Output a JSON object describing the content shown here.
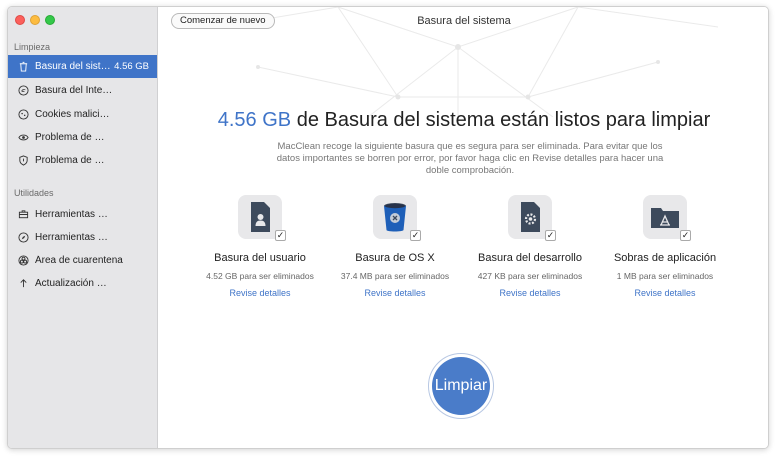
{
  "window": {
    "title": "Basura del sistema"
  },
  "toolbar": {
    "restart_label": "Comenzar de nuevo"
  },
  "sidebar": {
    "sections": [
      {
        "label": "Limpieza",
        "items": [
          {
            "label": "Basura del sistema",
            "size": "4.56 GB",
            "icon": "trash-icon",
            "active": true
          },
          {
            "label": "Basura del Internet",
            "icon": "internet-icon"
          },
          {
            "label": "Cookies maliciosas",
            "icon": "cookie-icon"
          },
          {
            "label": "Problema de privacidad",
            "icon": "eye-icon"
          },
          {
            "label": "Problema de seguridad",
            "icon": "shield-icon"
          }
        ]
      },
      {
        "label": "Utilidades",
        "items": [
          {
            "label": "Herramientas de limpieza",
            "icon": "toolbox-icon"
          },
          {
            "label": "Herramientas de seguridad",
            "icon": "compass-icon"
          },
          {
            "label": "Área de cuarentena",
            "icon": "biohazard-icon"
          },
          {
            "label": "Actualización de apps",
            "icon": "upload-icon"
          }
        ]
      }
    ]
  },
  "headline": {
    "size": "4.56 GB",
    "text": "de Basura del sistema están listos para limpiar"
  },
  "description": "MacClean recoge la siguiente basura que es segura para ser eliminada. Para evitar que los datos importantes se borren por error, por favor haga clic en Revise detalles para hacer una doble comprobación.",
  "categories": [
    {
      "title": "Basura del usuario",
      "subtitle": "4.52 GB para ser eliminados",
      "link": "Revise detalles",
      "icon": "user-file-icon",
      "checked": true
    },
    {
      "title": "Basura de OS X",
      "subtitle": "37.4 MB para ser eliminados",
      "link": "Revise detalles",
      "icon": "osx-trash-icon",
      "checked": true
    },
    {
      "title": "Basura del desarrollo",
      "subtitle": "427 KB para ser eliminados",
      "link": "Revise detalles",
      "icon": "gear-file-icon",
      "checked": true
    },
    {
      "title": "Sobras de aplicación",
      "subtitle": "1 MB para ser eliminados",
      "link": "Revise detalles",
      "icon": "app-folder-icon",
      "checked": true
    }
  ],
  "actions": {
    "clean_label": "Limpiar"
  },
  "colors": {
    "accent": "#3f74c8",
    "sidebar_bg": "#e6e6e8",
    "button": "#4a7cc9"
  }
}
